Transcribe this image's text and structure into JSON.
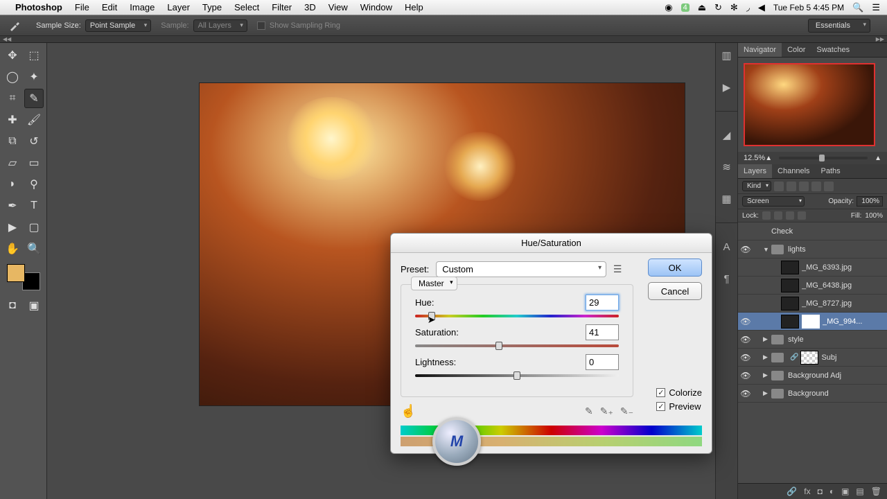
{
  "mac_menu": {
    "app": "Photoshop",
    "items": [
      "File",
      "Edit",
      "Image",
      "Layer",
      "Type",
      "Select",
      "Filter",
      "3D",
      "View",
      "Window",
      "Help"
    ],
    "clock": "Tue Feb 5  4:45 PM",
    "badge": "4"
  },
  "options_bar": {
    "sample_size_label": "Sample Size:",
    "sample_size_value": "Point Sample",
    "sample_label": "Sample:",
    "sample_value": "All Layers",
    "show_sampling_label": "Show Sampling Ring",
    "workspace": "Essentials"
  },
  "navigator": {
    "tabs": [
      "Navigator",
      "Color",
      "Swatches"
    ],
    "zoom": "12.5%"
  },
  "layers_panel": {
    "tabs": [
      "Layers",
      "Channels",
      "Paths"
    ],
    "kind_label": "Kind",
    "blend_mode": "Screen",
    "opacity_label": "Opacity:",
    "opacity_value": "100%",
    "lock_label": "Lock:",
    "fill_label": "Fill:",
    "fill_value": "100%",
    "items": [
      {
        "type": "layer",
        "name": "Check",
        "visible": false,
        "indent": 1
      },
      {
        "type": "group",
        "name": "lights",
        "visible": true,
        "open": true,
        "indent": 1
      },
      {
        "type": "layer",
        "name": "_MG_6393.jpg",
        "visible": false,
        "indent": 2,
        "thumb": true
      },
      {
        "type": "layer",
        "name": "_MG_6438.jpg",
        "visible": false,
        "indent": 2,
        "thumb": true
      },
      {
        "type": "layer",
        "name": "_MG_8727.jpg",
        "visible": false,
        "indent": 2,
        "thumb": true
      },
      {
        "type": "layer",
        "name": "_MG_994...",
        "visible": true,
        "indent": 2,
        "thumb": true,
        "mask": true,
        "selected": true
      },
      {
        "type": "group",
        "name": "style",
        "visible": true,
        "open": false,
        "indent": 1
      },
      {
        "type": "group",
        "name": "Subj",
        "visible": true,
        "open": false,
        "indent": 1,
        "mask": true,
        "link": true
      },
      {
        "type": "group",
        "name": "Background Adj",
        "visible": true,
        "open": false,
        "indent": 1
      },
      {
        "type": "group",
        "name": "Background",
        "visible": true,
        "open": false,
        "indent": 1
      }
    ]
  },
  "dialog": {
    "title": "Hue/Saturation",
    "preset_label": "Preset:",
    "preset_value": "Custom",
    "master": "Master",
    "hue_label": "Hue:",
    "hue_value": "29",
    "saturation_label": "Saturation:",
    "saturation_value": "41",
    "lightness_label": "Lightness:",
    "lightness_value": "0",
    "ok": "OK",
    "cancel": "Cancel",
    "colorize": "Colorize",
    "preview": "Preview"
  }
}
